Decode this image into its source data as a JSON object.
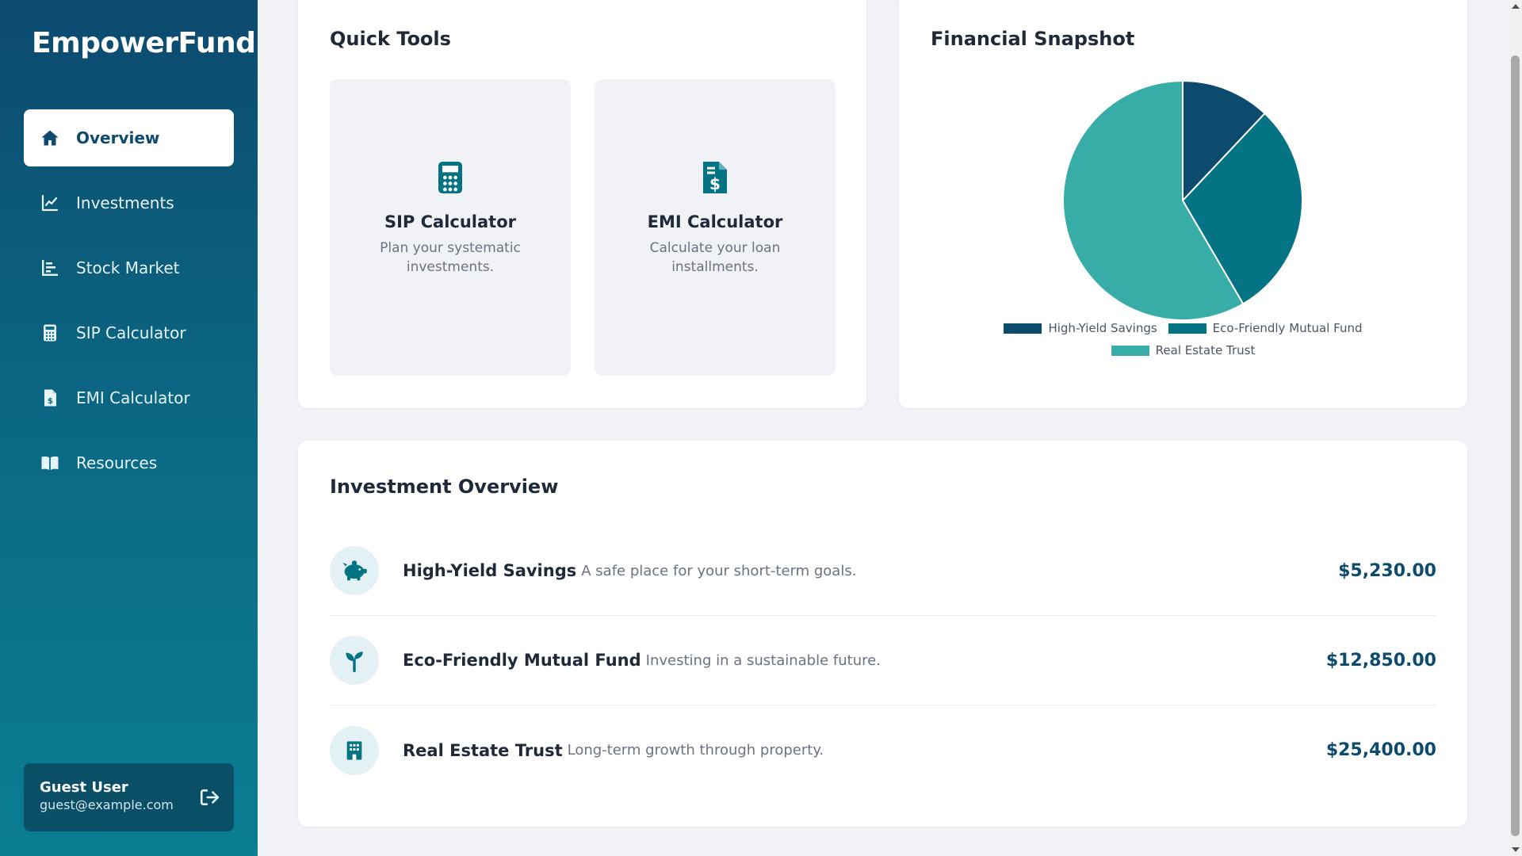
{
  "brand": "EmpowerFund",
  "sidebar": {
    "items": [
      {
        "label": "Overview",
        "icon": "home-icon",
        "active": true
      },
      {
        "label": "Investments",
        "icon": "line-chart-icon"
      },
      {
        "label": "Stock Market",
        "icon": "bar-chart-icon"
      },
      {
        "label": "SIP Calculator",
        "icon": "calculator-icon"
      },
      {
        "label": "EMI Calculator",
        "icon": "invoice-dollar-icon"
      },
      {
        "label": "Resources",
        "icon": "book-open-icon"
      }
    ],
    "user": {
      "name": "Guest User",
      "email": "guest@example.com"
    }
  },
  "quick_tools": {
    "title": "Quick Tools",
    "tools": [
      {
        "title": "SIP Calculator",
        "desc": "Plan your systematic investments.",
        "icon": "calculator-icon"
      },
      {
        "title": "EMI Calculator",
        "desc": "Calculate your loan installments.",
        "icon": "invoice-dollar-icon"
      }
    ]
  },
  "snapshot": {
    "title": "Financial Snapshot"
  },
  "chart_data": {
    "type": "pie",
    "title": "",
    "categories": [
      "High-Yield Savings",
      "Eco-Friendly Mutual Fund",
      "Real Estate Trust"
    ],
    "values": [
      5230,
      12850,
      25400
    ],
    "colors": [
      "#0c4a6e",
      "#047485",
      "#38aca6"
    ],
    "legend_position": "bottom"
  },
  "overview": {
    "title": "Investment Overview",
    "rows": [
      {
        "name": "High-Yield Savings",
        "desc": "A safe place for your short-term goals.",
        "amount": "$5,230.00",
        "icon": "piggy-bank-icon"
      },
      {
        "name": "Eco-Friendly Mutual Fund",
        "desc": "Investing in a sustainable future.",
        "amount": "$12,850.00",
        "icon": "seedling-icon"
      },
      {
        "name": "Real Estate Trust",
        "desc": "Long-term growth through property.",
        "amount": "$25,400.00",
        "icon": "building-icon"
      }
    ]
  },
  "colors": {
    "primary": "#0c4a6e",
    "accent": "#047485",
    "teal": "#38aca6",
    "background": "#f0f2f5"
  }
}
